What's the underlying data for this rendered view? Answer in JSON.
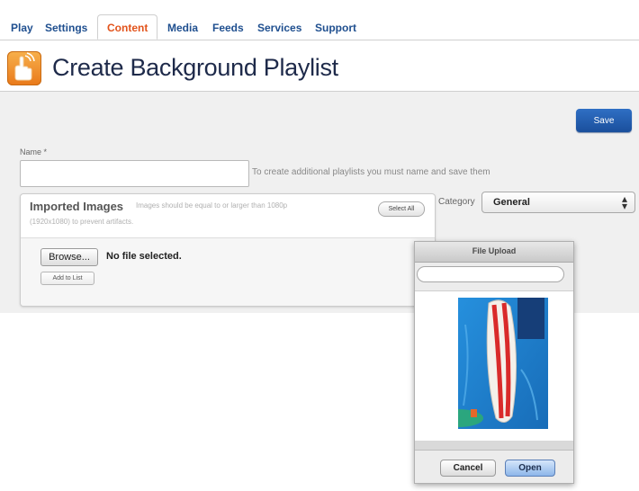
{
  "nav": {
    "tabs": [
      {
        "label": "Play"
      },
      {
        "label": "Settings"
      },
      {
        "label": "Content",
        "active": true
      },
      {
        "label": "Media"
      },
      {
        "label": "Feeds"
      },
      {
        "label": "Services"
      },
      {
        "label": "Support"
      }
    ]
  },
  "header": {
    "title": "Create Background Playlist",
    "icon": "touch-hand-icon"
  },
  "toolbar": {
    "save_label": "Save"
  },
  "form": {
    "name_label": "Name *",
    "name_value": "",
    "name_hint": "To create additional playlists you must name and save them",
    "category_label": "Category",
    "category_value": "General"
  },
  "imported": {
    "title": "Imported Images",
    "hint_line1": "Images should be equal to or larger than 1080p",
    "hint_line2": "(1920x1080) to prevent artifacts.",
    "select_all_label": "Select All",
    "browse_label": "Browse...",
    "file_status": "No file selected.",
    "add_to_list_label": "Add to List"
  },
  "dialog": {
    "title": "File Upload",
    "search_value": "",
    "cancel_label": "Cancel",
    "open_label": "Open",
    "preview": "surfboard-image"
  },
  "colors": {
    "active_tab": "#e2531b",
    "nav_link": "#1f4f8f",
    "save_button": "#1f5aa8",
    "title_text": "#1e2a4a",
    "logo_orange": "#f09a30"
  }
}
